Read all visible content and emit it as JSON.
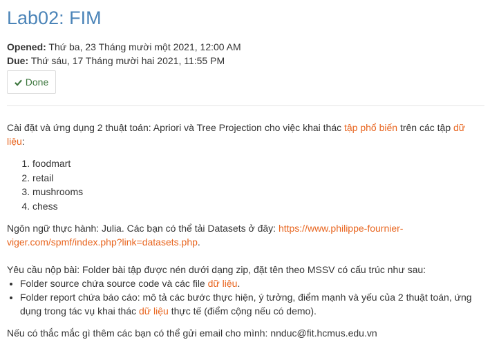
{
  "title": "Lab02: FIM",
  "opened": {
    "label": "Opened:",
    "value": " Thứ ba, 23 Tháng mười một 2021, 12:00 AM"
  },
  "due": {
    "label": "Due:",
    "value": " Thứ sáu, 17 Tháng mười hai 2021, 11:55 PM"
  },
  "done_button": {
    "label": "Done",
    "icon": "check-icon",
    "color": "#3c763d"
  },
  "intro": {
    "text1": "Cài đặt và ứng dụng 2 thuật toán: Apriori và Tree Projection cho việc khai thác ",
    "hl1": "tập phổ biến",
    "text2": " trên các tập ",
    "hl2": "dữ liệu",
    "text3": ":"
  },
  "datasets": [
    "foodmart",
    "retail",
    "mushrooms",
    "chess"
  ],
  "language": {
    "text": "Ngôn ngữ thực hành: Julia. Các bạn có thể tải Datasets ở đây: ",
    "link": "https://www.philippe-fournier-viger.com/spmf/index.php?link=datasets.php",
    "after": "."
  },
  "requirements": {
    "intro": "Yêu cầu nộp bài: Folder bài tập được nén dưới dạng zip, đặt tên theo MSSV có cấu trúc như sau:",
    "item1_text": "Folder source chứa source code và các file ",
    "item1_hl": "dữ liệu",
    "item1_after": ".",
    "item2_text": "Folder report chứa báo cáo: mô tả các bước thực hiện, ý tưởng, điểm mạnh và yếu của 2 thuật toán, ứng dụng trong tác vụ khai thác ",
    "item2_hl": "dữ liệu",
    "item2_after": " thực tế (điểm cộng nếu có demo)."
  },
  "contact": "Nếu có thắc mắc gì thêm các bạn có thể gửi email cho mình: nnduc@fit.hcmus.edu.vn",
  "colors": {
    "title": "#4b84b8",
    "highlight": "#e8651f",
    "text": "#333333"
  }
}
